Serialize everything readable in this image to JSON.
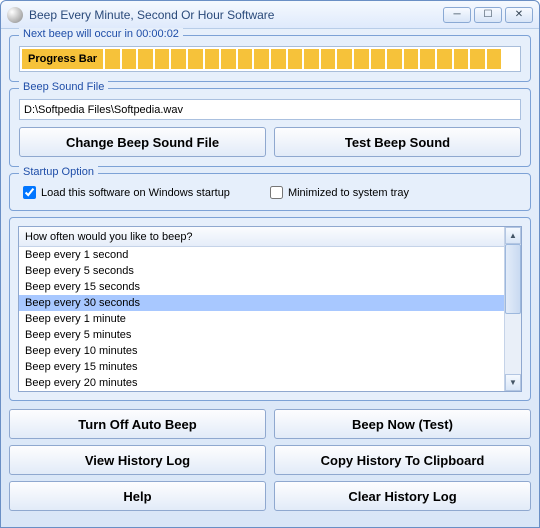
{
  "window": {
    "title": "Beep Every Minute, Second Or Hour Software"
  },
  "nextBeep": {
    "label": "Next beep will occur in 00:00:02",
    "progressLabel": "Progress Bar",
    "filledSegments": 24,
    "totalSegments": 25
  },
  "soundFile": {
    "groupTitle": "Beep Sound File",
    "path": "D:\\Softpedia Files\\Softpedia.wav",
    "changeBtn": "Change Beep Sound File",
    "testBtn": "Test Beep Sound"
  },
  "startup": {
    "groupTitle": "Startup Option",
    "loadOnStartup": {
      "label": "Load this software on Windows startup",
      "checked": true
    },
    "minimizeTray": {
      "label": "Minimized to system tray",
      "checked": false
    }
  },
  "intervalList": {
    "header": "How often would you like to beep?",
    "items": [
      "Beep every 1 second",
      "Beep every 5 seconds",
      "Beep every 15 seconds",
      "Beep every 30 seconds",
      "Beep every 1 minute",
      "Beep every 5 minutes",
      "Beep every 10 minutes",
      "Beep every 15 minutes",
      "Beep every 20 minutes"
    ],
    "selectedIndex": 3
  },
  "buttons": {
    "turnOff": "Turn Off Auto Beep",
    "beepNow": "Beep Now (Test)",
    "viewHistory": "View History Log",
    "copyHistory": "Copy History To Clipboard",
    "help": "Help",
    "clearHistory": "Clear History Log"
  }
}
